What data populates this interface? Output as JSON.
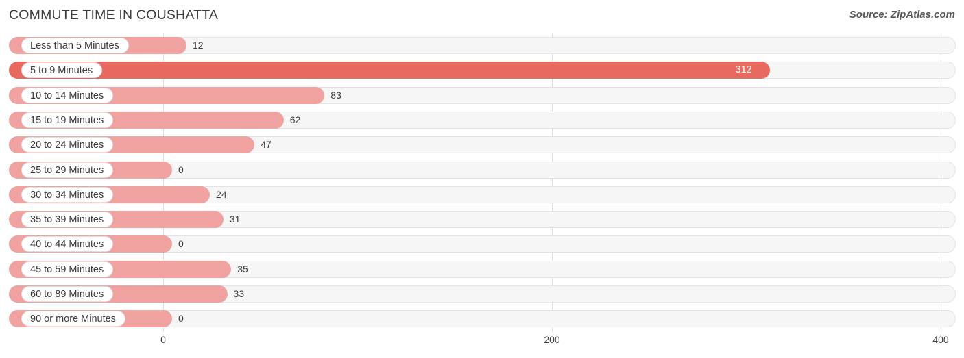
{
  "header": {
    "title": "COMMUTE TIME IN COUSHATTA",
    "source": "Source: ZipAtlas.com"
  },
  "colors": {
    "bar_light": "#efa2a0",
    "bar_accent": "#e8695f",
    "track": "#f6f6f6",
    "gridline": "#dedede",
    "text": "#3c3c3c"
  },
  "chart_data": {
    "type": "bar",
    "orientation": "horizontal",
    "title": "COMMUTE TIME IN COUSHATTA",
    "xlabel": "",
    "ylabel": "",
    "xlim": [
      0,
      400
    ],
    "ticks": [
      "0",
      "200",
      "400"
    ],
    "tick_values": [
      0,
      200,
      400
    ],
    "grid": true,
    "legend": null,
    "categories": [
      "Less than 5 Minutes",
      "5 to 9 Minutes",
      "10 to 14 Minutes",
      "15 to 19 Minutes",
      "20 to 24 Minutes",
      "25 to 29 Minutes",
      "30 to 34 Minutes",
      "35 to 39 Minutes",
      "40 to 44 Minutes",
      "45 to 59 Minutes",
      "60 to 89 Minutes",
      "90 or more Minutes"
    ],
    "values": [
      12,
      312,
      83,
      62,
      47,
      0,
      24,
      31,
      0,
      35,
      33,
      0
    ],
    "value_labels": [
      "12",
      "312",
      "83",
      "62",
      "47",
      "0",
      "24",
      "31",
      "0",
      "35",
      "33",
      "0"
    ],
    "highlighted_index": 1
  },
  "rows": [
    {
      "label": "Less than 5 Minutes",
      "value": "12",
      "highlight": false
    },
    {
      "label": "5 to 9 Minutes",
      "value": "312",
      "highlight": true
    },
    {
      "label": "10 to 14 Minutes",
      "value": "83",
      "highlight": false
    },
    {
      "label": "15 to 19 Minutes",
      "value": "62",
      "highlight": false
    },
    {
      "label": "20 to 24 Minutes",
      "value": "47",
      "highlight": false
    },
    {
      "label": "25 to 29 Minutes",
      "value": "0",
      "highlight": false
    },
    {
      "label": "30 to 34 Minutes",
      "value": "24",
      "highlight": false
    },
    {
      "label": "35 to 39 Minutes",
      "value": "31",
      "highlight": false
    },
    {
      "label": "40 to 44 Minutes",
      "value": "0",
      "highlight": false
    },
    {
      "label": "45 to 59 Minutes",
      "value": "35",
      "highlight": false
    },
    {
      "label": "60 to 89 Minutes",
      "value": "33",
      "highlight": false
    },
    {
      "label": "90 or more Minutes",
      "value": "0",
      "highlight": false
    }
  ],
  "axis": {
    "ticks": [
      {
        "label": "0",
        "value": 0
      },
      {
        "label": "200",
        "value": 200
      },
      {
        "label": "400",
        "value": 400
      }
    ]
  }
}
